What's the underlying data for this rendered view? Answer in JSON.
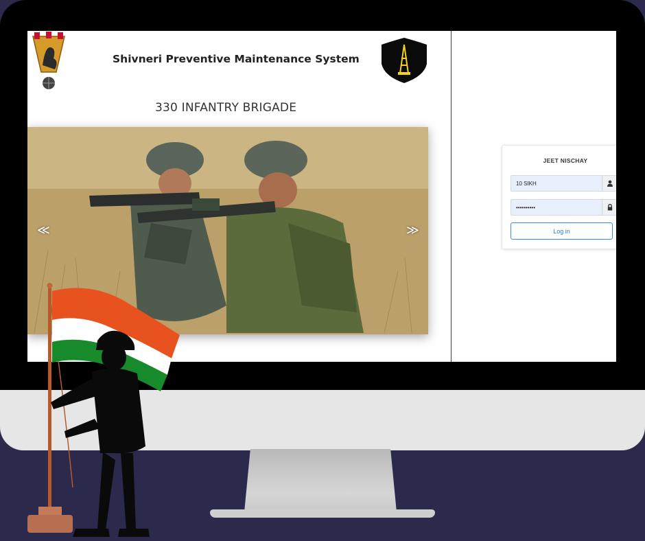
{
  "app": {
    "title": "Shivneri Preventive Maintenance System",
    "unit": "330 INFANTRY BRIGADE"
  },
  "carousel": {
    "prev_label": "≪",
    "next_label": "≫"
  },
  "login": {
    "title": "JEET NISCHAY",
    "username_value": "10 SIKH",
    "password_value": "••••••••••",
    "submit_label": "Log in"
  },
  "icons": {
    "user": "user-icon",
    "lock": "lock-icon"
  },
  "colors": {
    "background": "#2b2a4c",
    "accent": "#2f7bd1",
    "input_fill": "#e8f0fe",
    "flag_saffron": "#e8521f",
    "flag_green": "#178a2c"
  }
}
